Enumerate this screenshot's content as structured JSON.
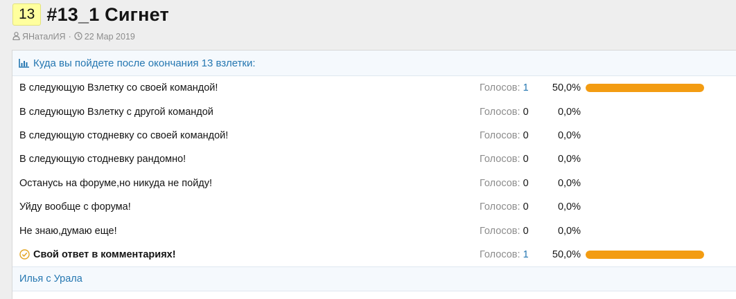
{
  "thread": {
    "prefix": "13",
    "title": "#13_1 Сигнет",
    "author": "ЯНаталИЯ",
    "separator": "·",
    "date": "22 Мар 2019"
  },
  "poll": {
    "question": "Куда вы пойдете после окончания 13 взлетки:",
    "votes_label": "Голосов:",
    "options": [
      {
        "label": "В следующую Взлетку со своей командой!",
        "votes": "1",
        "percent": "50,0%",
        "fraction": 0.5,
        "selected": false
      },
      {
        "label": "В следующую Взлетку с другой командой",
        "votes": "0",
        "percent": "0,0%",
        "fraction": 0,
        "selected": false
      },
      {
        "label": "В следующую стодневку со своей командой!",
        "votes": "0",
        "percent": "0,0%",
        "fraction": 0,
        "selected": false
      },
      {
        "label": "В следующую стодневку рандомно!",
        "votes": "0",
        "percent": "0,0%",
        "fraction": 0,
        "selected": false
      },
      {
        "label": "Останусь на форуме,но никуда не пойду!",
        "votes": "0",
        "percent": "0,0%",
        "fraction": 0,
        "selected": false
      },
      {
        "label": "Уйду вообще с форума!",
        "votes": "0",
        "percent": "0,0%",
        "fraction": 0,
        "selected": false
      },
      {
        "label": "Не знаю,думаю еще!",
        "votes": "0",
        "percent": "0,0%",
        "fraction": 0,
        "selected": false
      },
      {
        "label": "Свой ответ в комментариях!",
        "votes": "1",
        "percent": "50,0%",
        "fraction": 0.5,
        "selected": true
      }
    ]
  },
  "footer": {
    "user": "Илья с Урала"
  },
  "colors": {
    "accent": "#2577b1",
    "bar": "#f39c12",
    "prefix_bg": "#ffff9e",
    "check": "#e3a521"
  },
  "icons": {
    "author": "user-icon",
    "date": "clock-icon",
    "poll": "bar-chart-icon",
    "selected": "check-circle-icon"
  }
}
